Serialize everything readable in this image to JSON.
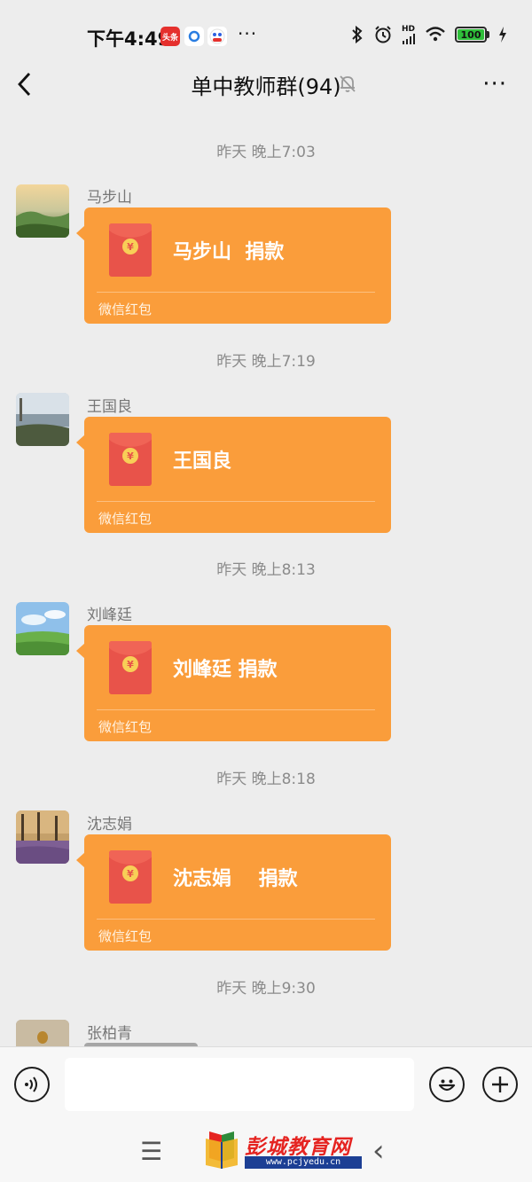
{
  "status_bar": {
    "time": "下午4:49",
    "app_badges": [
      "头条"
    ],
    "battery": "100",
    "network": "HD"
  },
  "nav": {
    "title": "单中教师群(94)"
  },
  "messages": [
    {
      "timestamp": "昨天 晚上7:03",
      "sender": "马步山",
      "text": "马步山  捐款",
      "footer": "微信红包"
    },
    {
      "timestamp": "昨天 晚上7:19",
      "sender": "王国良",
      "text": "王国良",
      "footer": "微信红包"
    },
    {
      "timestamp": "昨天 晚上8:13",
      "sender": "刘峰廷",
      "text": "刘峰廷 捐款",
      "footer": "微信红包"
    },
    {
      "timestamp": "昨天 晚上8:18",
      "sender": "沈志娟",
      "text": "沈志娟    捐款",
      "footer": "微信红包"
    },
    {
      "timestamp": "昨天 晚上9:30",
      "sender": "张柏青"
    }
  ],
  "watermark": {
    "title": "彭城教育网",
    "url": "www.pcjyedu.cn"
  }
}
